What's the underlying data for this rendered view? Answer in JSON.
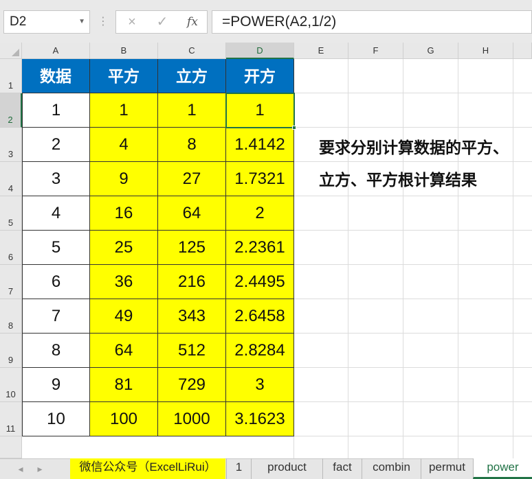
{
  "formula_bar": {
    "name_box": "D2",
    "cancel_icon": "×",
    "enter_icon": "✓",
    "fx_label": "fx",
    "formula": "=POWER(A2,1/2)"
  },
  "columns": [
    "A",
    "B",
    "C",
    "D",
    "E",
    "F",
    "G",
    "H"
  ],
  "rows": [
    "1",
    "2",
    "3",
    "4",
    "5",
    "6",
    "7",
    "8",
    "9",
    "10",
    "11"
  ],
  "table": {
    "headers": [
      "数据",
      "平方",
      "立方",
      "开方"
    ],
    "data": [
      [
        "1",
        "1",
        "1",
        "1"
      ],
      [
        "2",
        "4",
        "8",
        "1.4142"
      ],
      [
        "3",
        "9",
        "27",
        "1.7321"
      ],
      [
        "4",
        "16",
        "64",
        "2"
      ],
      [
        "5",
        "25",
        "125",
        "2.2361"
      ],
      [
        "6",
        "36",
        "216",
        "2.4495"
      ],
      [
        "7",
        "49",
        "343",
        "2.6458"
      ],
      [
        "8",
        "64",
        "512",
        "2.8284"
      ],
      [
        "9",
        "81",
        "729",
        "3"
      ],
      [
        "10",
        "100",
        "1000",
        "3.1623"
      ]
    ]
  },
  "note": {
    "line1": "要求分别计算数据的平方、",
    "line2": "立方、平方根计算结果"
  },
  "tabs": {
    "ad": "微信公众号（ExcelLiRui）",
    "items": [
      "1",
      "product",
      "fact",
      "combin",
      "permut",
      "power"
    ],
    "active": "power"
  },
  "colors": {
    "header_fill": "#0070c0",
    "value_fill": "#ffff00",
    "selection": "#217346"
  }
}
